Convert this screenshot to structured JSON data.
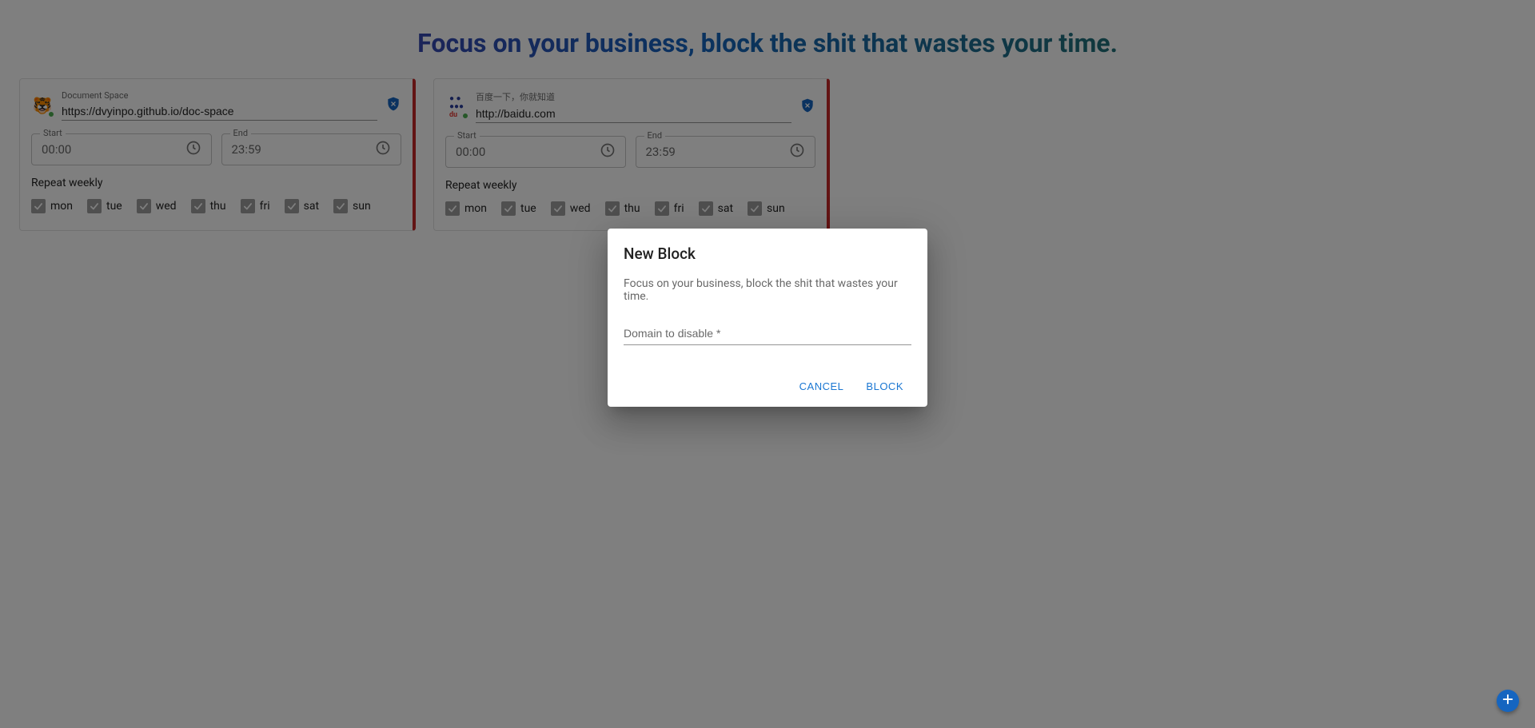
{
  "page_title": "Focus on your business, block the shit that wastes your time.",
  "cards": [
    {
      "site_title": "Document Space",
      "url": "https://dvyinpo.github.io/doc-space",
      "start_label": "Start",
      "start_value": "00:00",
      "end_label": "End",
      "end_value": "23:59",
      "repeat_label": "Repeat weekly",
      "favicon": "🐯"
    },
    {
      "site_title": "百度一下，你就知道",
      "url": "http://baidu.com",
      "start_label": "Start",
      "start_value": "00:00",
      "end_label": "End",
      "end_value": "23:59",
      "repeat_label": "Repeat weekly",
      "favicon": "paw"
    }
  ],
  "days": [
    "mon",
    "tue",
    "wed",
    "thu",
    "fri",
    "sat",
    "sun"
  ],
  "dialog": {
    "title": "New Block",
    "subtitle": "Focus on your business, block the shit that wastes your time.",
    "input_placeholder": "Domain to disable *",
    "cancel": "CANCEL",
    "block": "BLOCK"
  }
}
